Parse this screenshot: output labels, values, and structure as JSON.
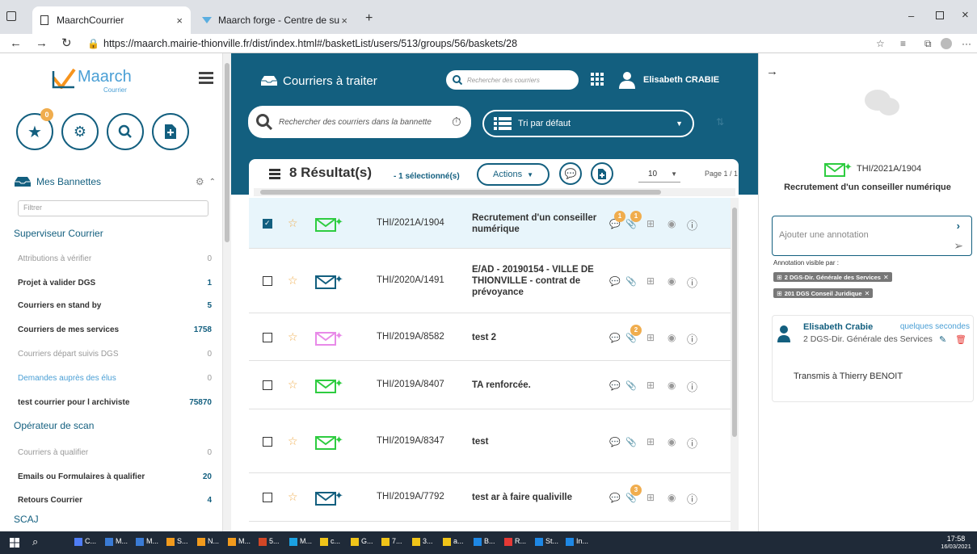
{
  "browser": {
    "tabs": [
      {
        "title": "MaarchCourrier",
        "close": "×"
      },
      {
        "title": "Maarch forge - Centre de suppo",
        "close": "×"
      }
    ],
    "new_tab": "+",
    "url": "https://maarch.mairie-thionville.fr/dist/index.html#/basketList/users/513/groups/56/baskets/28"
  },
  "sidebar": {
    "logo_text": "Maarch",
    "logo_sub": "Courrier",
    "fav_badge": "0",
    "section_title": "Mes Bannettes",
    "filter_placeholder": "Filtrer",
    "groups": [
      {
        "name": "Superviseur Courrier"
      },
      {
        "name": "Opérateur de scan"
      },
      {
        "name": "SCAJ"
      }
    ],
    "baskets": [
      {
        "label": "Attributions à vérifier",
        "count": "0"
      },
      {
        "label": "Projet à valider DGS",
        "count": "1"
      },
      {
        "label": "Courriers en stand by",
        "count": "5"
      },
      {
        "label": "Courriers de mes services",
        "count": "1758"
      },
      {
        "label": "Courriers départ suivis DGS",
        "count": "0"
      },
      {
        "label": "Demandes auprès des élus",
        "count": "0"
      },
      {
        "label": "test courrier pour l archiviste",
        "count": "75870"
      },
      {
        "label": "Courriers à qualifier",
        "count": "0"
      },
      {
        "label": "Emails ou Formulaires à qualifier",
        "count": "20"
      },
      {
        "label": "Retours Courrier",
        "count": "4"
      }
    ]
  },
  "header": {
    "title": "Courriers à traiter",
    "search_placeholder": "Rechercher des courriers",
    "user_name": "Elisabeth CRABIE",
    "basket_search_placeholder": "Rechercher des courriers dans la bannette",
    "sort_label": "Tri par défaut"
  },
  "results": {
    "count_text": "8 Résultat(s)",
    "selected_text": "- 1 sélectionné(s)",
    "actions_label": "Actions",
    "page_size": "10",
    "page_label": "Page 1 / 1"
  },
  "rows": [
    {
      "ref": "THI/2021A/1904",
      "subject": "Recrutement d'un conseiller numérique",
      "selected": true,
      "notes_badge": "1",
      "attach_badge": "1",
      "mail_color": "#2ecc40"
    },
    {
      "ref": "THI/2020A/1491",
      "subject": "E/AD - 20190154 - VILLE DE THIONVILLE - contrat de prévoyance",
      "selected": false,
      "notes_badge": "",
      "attach_badge": "",
      "mail_color": "#135f7f"
    },
    {
      "ref": "THI/2019A/8582",
      "subject": "test 2",
      "selected": false,
      "notes_badge": "",
      "attach_badge": "2",
      "mail_color": "#e88ae8"
    },
    {
      "ref": "THI/2019A/8407",
      "subject": "TA renforcée.",
      "selected": false,
      "notes_badge": "",
      "attach_badge": "",
      "mail_color": "#2ecc40"
    },
    {
      "ref": "THI/2019A/8347",
      "subject": "test",
      "selected": false,
      "notes_badge": "",
      "attach_badge": "",
      "mail_color": "#2ecc40"
    },
    {
      "ref": "THI/2019A/7792",
      "subject": "test ar à faire qualiville",
      "selected": false,
      "notes_badge": "",
      "attach_badge": "3",
      "mail_color": "#135f7f"
    }
  ],
  "panel": {
    "ref": "THI/2021A/1904",
    "subject": "Recrutement d'un conseiller numérique",
    "annotation_placeholder": "Ajouter une annotation",
    "visible_label": "Annotation visible par :",
    "visibility_tags": [
      "2 DGS-Dir. Générale des Services",
      "201 DGS Conseil Juridique"
    ],
    "note": {
      "author": "Elisabeth Crabie",
      "time": "quelques secondes",
      "entity": "2 DGS-Dir. Générale des Services",
      "text": "Transmis à Thierry BENOIT"
    }
  },
  "taskbar": {
    "items": [
      "C...",
      "M...",
      "M...",
      "S...",
      "N...",
      "M...",
      "5...",
      "M...",
      "c...",
      "G...",
      "7...",
      "3...",
      "a...",
      "B...",
      "R...",
      "St...",
      "In..."
    ],
    "time": "17:58",
    "date": "16/03/2021"
  }
}
